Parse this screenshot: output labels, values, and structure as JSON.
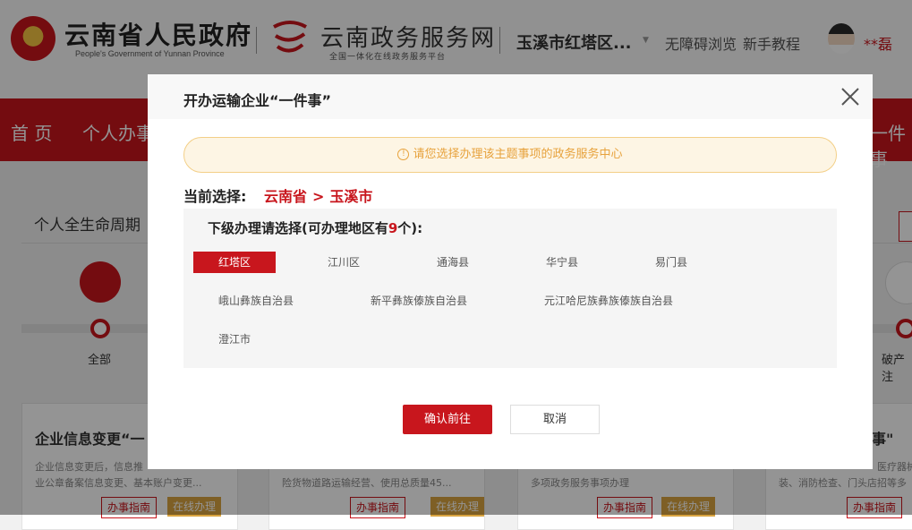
{
  "header": {
    "gov_title": "云南省人民政府",
    "gov_subtitle": "People's Government of Yunnan Province",
    "portal_title": "云南政务服务网",
    "portal_subtitle": "全国一体化在线政务服务平台",
    "region_selector": "玉溪市红塔区...",
    "accessibility_link": "无障碍浏览",
    "tutorial_link": "新手教程",
    "username": "**磊"
  },
  "nav": {
    "items": [
      "首 页",
      "个人办事",
      "一件事"
    ]
  },
  "lifecycle": {
    "title": "个人全生命周期",
    "categories": [
      "全部",
      "破产注"
    ]
  },
  "cards": [
    {
      "title": "企业信息变更“一",
      "desc": [
        "企业信息变更后，信息推",
        "业公章备案信息变更、基本账户变更..."
      ],
      "guide": "办事指南",
      "online": "在线办理"
    },
    {
      "desc": [
        "险货物道路运输经营、使用总质量45..."
      ],
      "guide": "办事指南",
      "online": "在线办理"
    },
    {
      "desc": [
        "多项政务服务事项办理"
      ],
      "guide": "办事指南",
      "online": "在线办理"
    },
    {
      "title": "事\"",
      "desc": [
        "医疗器械",
        "装、消防检查、门头店招等多"
      ],
      "guide": "办事指南"
    }
  ],
  "modal": {
    "title": "开办运输企业“一件事”",
    "notice_icon": "!",
    "notice": "请您选择办理该主题事项的政务服务中心",
    "current_label": "当前选择:",
    "path": [
      "云南省",
      "玉溪市"
    ],
    "path_separator": ">",
    "panel_prefix": "下级办理请选择(可办理地区有",
    "panel_count": "9",
    "panel_suffix": "个):",
    "regions": [
      "红塔区",
      "江川区",
      "通海县",
      "华宁县",
      "易门县",
      "峨山彝族自治县",
      "新平彝族傣族自治县",
      "元江哈尼族彝族傣族自治县",
      "澄江市"
    ],
    "selected_region": "红塔区",
    "confirm_label": "确认前往",
    "cancel_label": "取消"
  },
  "colors": {
    "brand_red": "#c8161d",
    "notice_orange": "#e7a23c",
    "online_gold": "#d9a441"
  }
}
